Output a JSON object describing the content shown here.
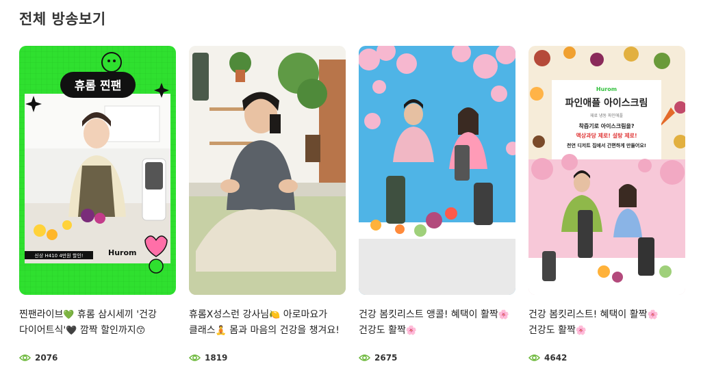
{
  "page": {
    "title": "전체 방송보기"
  },
  "colors": {
    "eye": "#6cb83a",
    "accent_green": "#2fe32f"
  },
  "cards": [
    {
      "title_parts": [
        "찐팬라이브",
        "💚",
        " 휴롬 삼시세끼 '건강 다이어트식'",
        "🖤",
        " 깜짝 할인까지",
        "😙"
      ],
      "views": "2076",
      "thumb": {
        "badge_top": "휴롬 찐팬",
        "banner": "신상 H410 4만원 할인!",
        "brand": "Hurom"
      }
    },
    {
      "title_parts": [
        "휴롬X성스런 강사님",
        "🍋",
        " 아로마요가 클래스",
        "🧘",
        " 몸과 마음의 건강을 챙겨요!"
      ],
      "views": "1819",
      "thumb": {}
    },
    {
      "title_parts": [
        "건강 봄킷리스트 앵콜! 혜택이 활짝",
        "🌸",
        " 건강도 활짝",
        "🌸"
      ],
      "views": "2675",
      "thumb": {}
    },
    {
      "title_parts": [
        "건강 봄킷리스트! 혜택이 활짝",
        "🌸",
        " 건강도 활짝",
        "🌸"
      ],
      "views": "4642",
      "thumb": {
        "brand": "Hurom",
        "heading": "파인애플 아이스크림",
        "sub": "재료  냉동 파인애플",
        "line1": "착즙기로 아이스크림을?",
        "line2": "액상과당 제로! 설탕 제로!",
        "line3": "천연 디저트 집에서 간편하게 만들어요!"
      }
    }
  ]
}
